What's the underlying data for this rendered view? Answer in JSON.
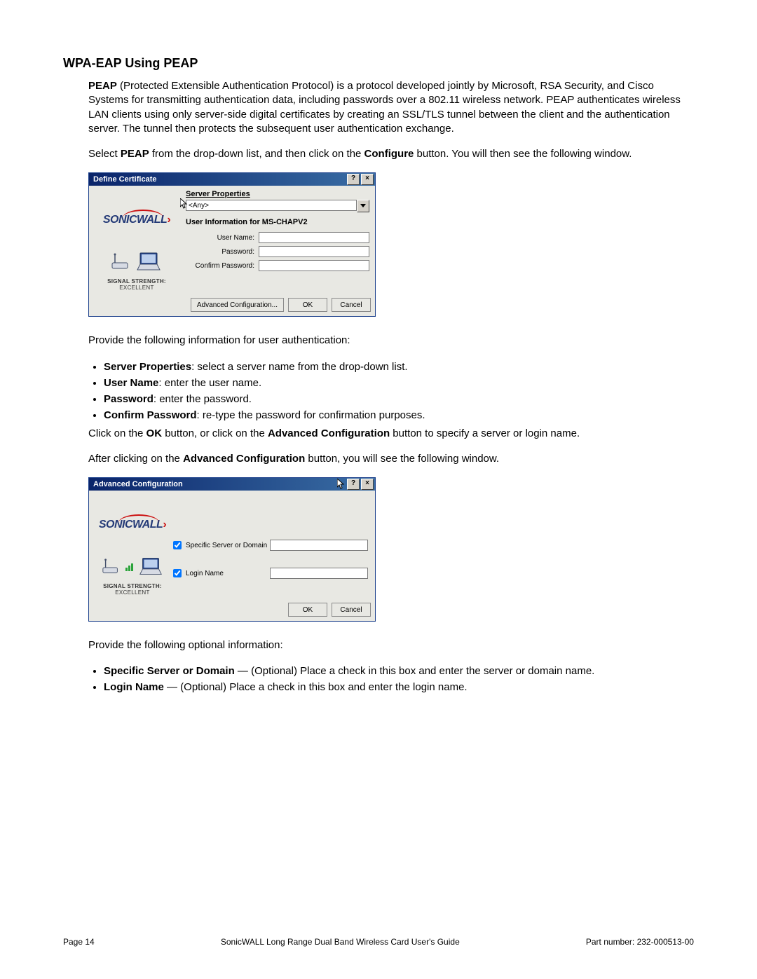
{
  "heading": "WPA-EAP Using PEAP",
  "para1": {
    "lead_bold": "PEAP",
    "rest": " (Protected Extensible Authentication Protocol) is a protocol developed jointly by Microsoft, RSA Security, and Cisco Systems for transmitting authentication data, including passwords over a 802.11 wireless network. PEAP authenticates wireless LAN clients using only server-side digital certificates by creating an SSL/TLS tunnel between the client and the authentication server. The tunnel then protects the subsequent user authentication exchange."
  },
  "para2": {
    "pre": "Select ",
    "b1": "PEAP",
    "mid": " from the drop-down list, and then click on the ",
    "b2": "Configure",
    "post": " button. You will then see the following window."
  },
  "dialog1": {
    "title": "Define Certificate",
    "logo_text": "SONICWALL",
    "signal_label": "SIGNAL STRENGTH:",
    "signal_value": " EXCELLENT",
    "server_properties_label": "Server Properties",
    "server_combo_value": "<Any>",
    "user_info_header": "User Information for MS-CHAPV2",
    "rows": {
      "username_label": "User Name:",
      "password_label": "Password:",
      "confirm_label": "Confirm Password:"
    },
    "buttons": {
      "advanced": "Advanced Configuration...",
      "ok": "OK",
      "cancel": "Cancel"
    }
  },
  "para3": "Provide the following information for user authentication:",
  "list1": [
    {
      "b": "Server Properties",
      "rest": ": select a server name from the drop-down list."
    },
    {
      "b": "User Name",
      "rest": ": enter the user name."
    },
    {
      "b": "Password",
      "rest": ": enter the password."
    },
    {
      "b": "Confirm Password",
      "rest": ": re-type the password for confirmation purposes."
    }
  ],
  "para4": {
    "pre": "Click on the ",
    "b1": "OK",
    "mid": " button, or click on the ",
    "b2": "Advanced Configuration",
    "post": " button to specify a server or login name."
  },
  "para5": {
    "pre": "After clicking on the ",
    "b1": "Advanced Configuration",
    "post": " button, you will see the following window."
  },
  "dialog2": {
    "title": "Advanced Configuration",
    "logo_text": "SONICWALL",
    "signal_label": "SIGNAL STRENGTH:",
    "signal_value": " EXCELLENT",
    "row1_label": "Specific Server or Domain",
    "row2_label": "Login Name",
    "buttons": {
      "ok": "OK",
      "cancel": "Cancel"
    }
  },
  "para6": "Provide the following optional information:",
  "list2": [
    {
      "b": "Specific Server or Domain",
      "rest": " — (Optional) Place a check in this box and enter the server or domain name."
    },
    {
      "b": "Login Name",
      "rest": " — (Optional) Place a check in this box and enter the login name."
    }
  ],
  "footer": {
    "page": "Page 14",
    "center": "SonicWALL Long Range Dual Band Wireless Card User's Guide",
    "part": "Part number: 232-000513-00"
  }
}
